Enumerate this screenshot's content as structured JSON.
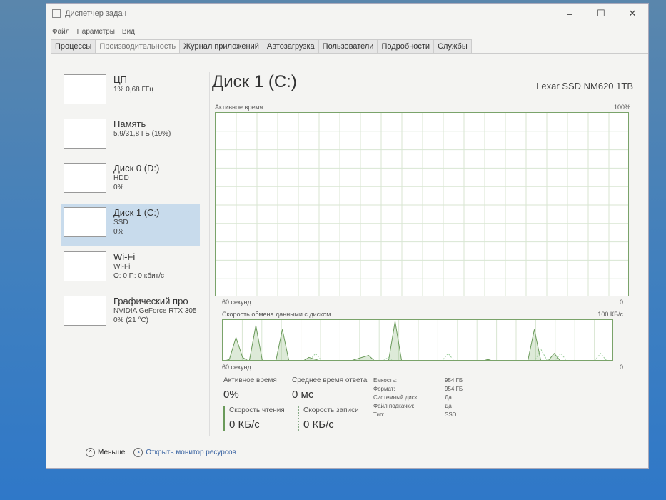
{
  "window": {
    "title": "Диспетчер задач",
    "controls": [
      "–",
      "☐",
      "✕"
    ]
  },
  "menu": [
    "Файл",
    "Параметры",
    "Вид"
  ],
  "tabs": [
    "Процессы",
    "Производительность",
    "Журнал приложений",
    "Автозагрузка",
    "Пользователи",
    "Подробности",
    "Службы"
  ],
  "sidebar": [
    {
      "name": "ЦП",
      "sub1": "1% 0,68 ГГц",
      "sub2": ""
    },
    {
      "name": "Память",
      "sub1": "5,9/31,8 ГБ (19%)",
      "sub2": ""
    },
    {
      "name": "Диск 0 (D:)",
      "sub1": "HDD",
      "sub2": "0%"
    },
    {
      "name": "Диск 1 (C:)",
      "sub1": "SSD",
      "sub2": "0%"
    },
    {
      "name": "Wi-Fi",
      "sub1": "Wi-Fi",
      "sub2": "О: 0 П: 0 кбит/с"
    },
    {
      "name": "Графический про",
      "sub1": "NVIDIA GeForce RTX 305",
      "sub2": "0% (21 °C)"
    }
  ],
  "main": {
    "title": "Диск 1 (C:)",
    "model": "Lexar SSD NM620 1TB",
    "chart1": {
      "label": "Активное время",
      "max": "100%",
      "xlabel": "60 секунд",
      "min": "0"
    },
    "chart2": {
      "label": "Скорость обмена данными с диском",
      "max": "100 КБ/с",
      "xlabel": "60 секунд",
      "min": "0"
    },
    "stats": {
      "active_label": "Активное время",
      "active": "0%",
      "resp_label": "Среднее время ответа",
      "resp": "0 мс",
      "read_label": "Скорость чтения",
      "read": "0 КБ/с",
      "write_label": "Скорость записи",
      "write": "0 КБ/с"
    },
    "props": [
      [
        "Емкость:",
        "954 ГБ"
      ],
      [
        "Формат:",
        "954 ГБ"
      ],
      [
        "Системный диск:",
        "Да"
      ],
      [
        "Файл подкачки:",
        "Да"
      ],
      [
        "Тип:",
        "SSD"
      ]
    ]
  },
  "chart_data": {
    "type": "line",
    "title": "Скорость обмена данными с диском",
    "ylim": [
      0,
      100
    ],
    "series": [
      {
        "name": "read",
        "values": [
          0,
          5,
          60,
          10,
          0,
          90,
          0,
          0,
          0,
          80,
          0,
          0,
          0,
          10,
          5,
          0,
          0,
          0,
          0,
          0,
          5,
          10,
          15,
          0,
          0,
          0,
          100,
          0,
          0,
          0,
          0,
          0,
          0,
          0,
          0,
          0,
          0,
          0,
          0,
          0,
          5,
          0,
          0,
          0,
          0,
          0,
          0,
          80,
          0,
          0,
          20,
          0,
          0,
          0,
          0,
          0,
          0,
          0,
          0,
          0
        ]
      },
      {
        "name": "write",
        "values": [
          0,
          0,
          0,
          0,
          0,
          0,
          0,
          0,
          0,
          0,
          0,
          0,
          0,
          0,
          20,
          0,
          0,
          0,
          0,
          0,
          0,
          0,
          0,
          0,
          0,
          10,
          0,
          0,
          0,
          0,
          0,
          0,
          0,
          0,
          20,
          0,
          0,
          0,
          0,
          0,
          0,
          0,
          0,
          0,
          0,
          0,
          0,
          0,
          30,
          0,
          0,
          20,
          0,
          0,
          0,
          0,
          0,
          20,
          0,
          0
        ]
      }
    ]
  },
  "footer": {
    "less": "Меньше",
    "monitor": "Открыть монитор ресурсов"
  }
}
